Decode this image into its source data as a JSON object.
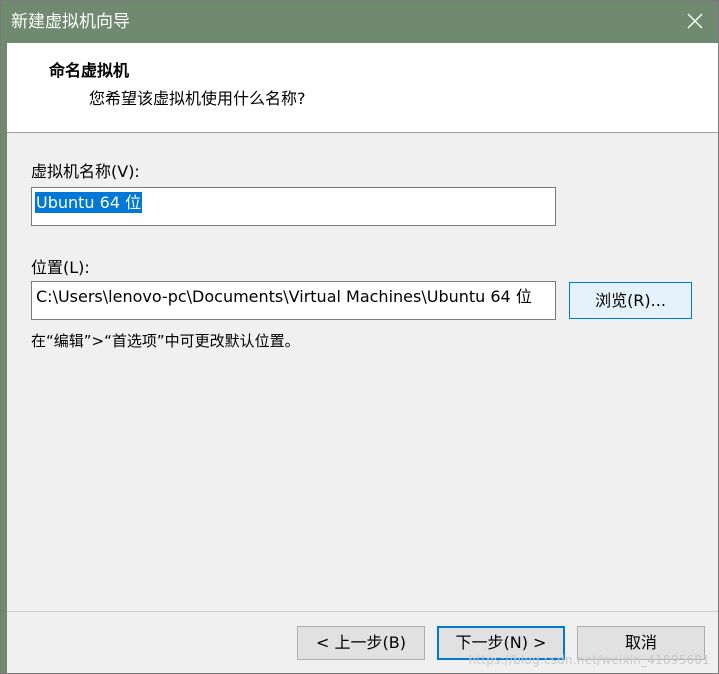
{
  "window": {
    "title": "新建虚拟机向导"
  },
  "header": {
    "title": "命名虚拟机",
    "subtitle": "您希望该虚拟机使用什么名称?"
  },
  "form": {
    "name_label": "虚拟机名称(V):",
    "name_value": "Ubuntu 64 位",
    "location_label": "位置(L):",
    "location_value": "C:\\Users\\lenovo-pc\\Documents\\Virtual Machines\\Ubuntu 64 位",
    "browse_label": "浏览(R)...",
    "hint": "在“编辑”>“首选项”中可更改默认位置。"
  },
  "footer": {
    "back_label": "< 上一步(B)",
    "next_label": "下一步(N) >",
    "cancel_label": "取消"
  },
  "watermark": "https://blog.csdn.net/weixin_41895601",
  "colors": {
    "titlebar": "#6f8a6e",
    "selection": "#0078d7",
    "focus_border": "#0078d7"
  }
}
